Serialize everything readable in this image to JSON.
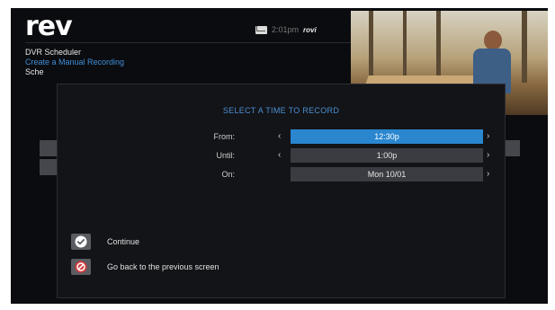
{
  "header": {
    "logo": "rev",
    "time": "2:01pm",
    "brand": "rovi"
  },
  "breadcrumb": {
    "section": "DVR Scheduler",
    "current": "Create a Manual Recording",
    "partial": "Sche"
  },
  "dialog": {
    "title": "SELECT A TIME TO RECORD",
    "rows": [
      {
        "label": "From:",
        "value": "12:30p"
      },
      {
        "label": "Until:",
        "value": "1:00p"
      },
      {
        "label": "On:",
        "value": "Mon 10/01"
      }
    ],
    "actions": {
      "continue": "Continue",
      "back": "Go back to the previous screen"
    }
  },
  "icons": {
    "left_arrow": "‹",
    "right_arrow": "›"
  },
  "colors": {
    "accent": "#2a86cf",
    "title_blue": "#4b8fd1",
    "cancel_red": "#d63b3b"
  }
}
